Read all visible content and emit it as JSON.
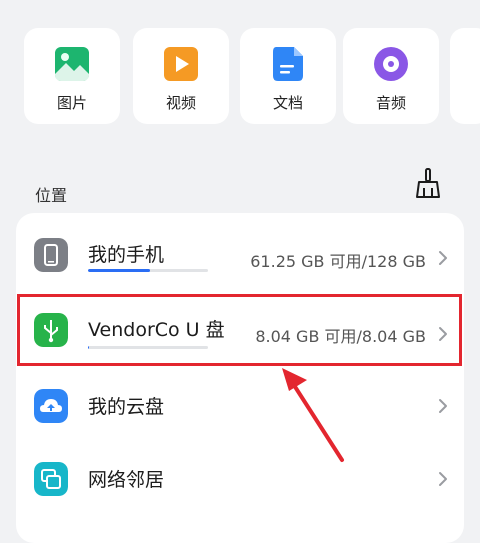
{
  "categories": [
    {
      "label": "图片",
      "icon": "image-icon"
    },
    {
      "label": "视频",
      "icon": "video-icon"
    },
    {
      "label": "文档",
      "icon": "document-icon"
    },
    {
      "label": "音频",
      "icon": "audio-icon"
    }
  ],
  "location": {
    "title": "位置",
    "clean_icon": "broom-icon"
  },
  "storage": [
    {
      "title": "我的手机",
      "meta": "61.25 GB 可用/128 GB",
      "used_fraction": 0.52,
      "icon": "phone-icon"
    },
    {
      "title": "VendorCo U 盘",
      "meta": "8.04 GB 可用/8.04 GB",
      "used_fraction": 0.01,
      "icon": "usb-icon"
    },
    {
      "title": "我的云盘",
      "icon": "cloud-icon"
    },
    {
      "title": "网络邻居",
      "icon": "network-icon"
    }
  ],
  "colors": {
    "accent": "#2a6df4",
    "highlight": "#e3262f"
  }
}
